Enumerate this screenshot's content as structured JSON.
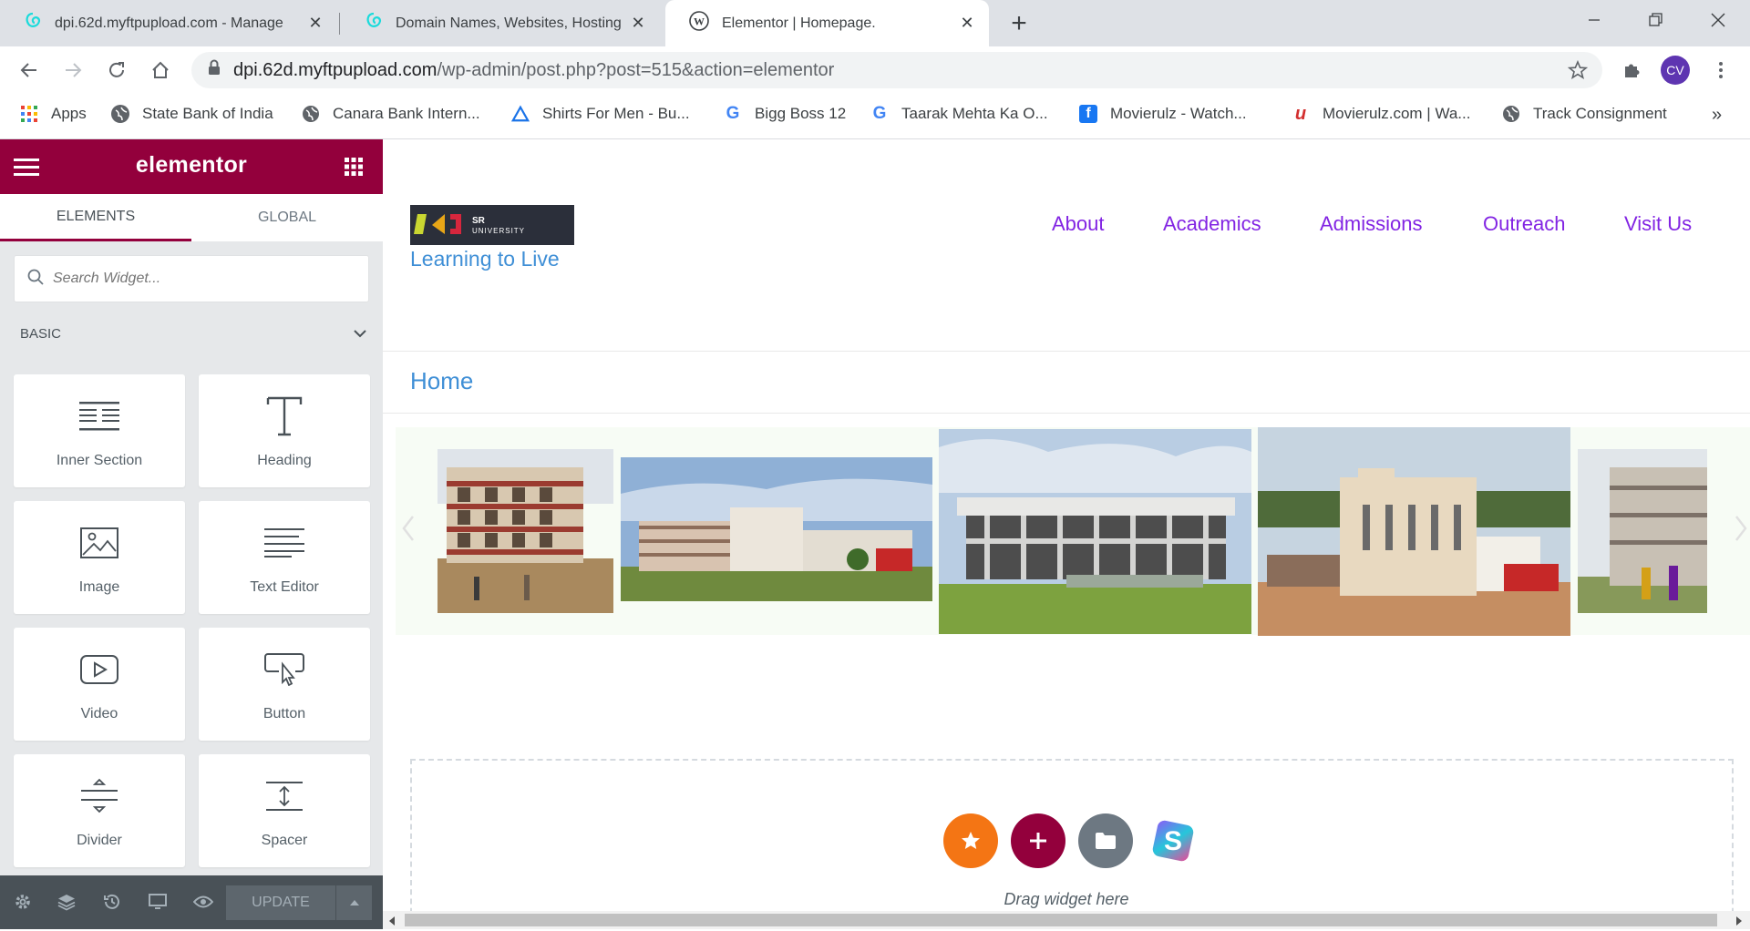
{
  "browser": {
    "tabs": [
      {
        "title": "dpi.62d.myftpupload.com - Manage",
        "icon": "godaddy-icon"
      },
      {
        "title": "Domain Names, Websites, Hosting",
        "icon": "godaddy-icon"
      },
      {
        "title": "Elementor | Homepage.",
        "icon": "wordpress-icon",
        "active": true
      }
    ],
    "new_tab": "+",
    "url_host": "dpi.62d.myftpupload.com",
    "url_path": "/wp-admin/post.php?post=515&action=elementor",
    "profile_initials": "CV",
    "bookmarks": [
      {
        "label": "Apps",
        "icon": "apps-grid-icon"
      },
      {
        "label": "State Bank of India",
        "icon": "globe-icon"
      },
      {
        "label": "Canara Bank Intern...",
        "icon": "globe-icon"
      },
      {
        "label": "Shirts For Men - Bu...",
        "icon": "triangle-logo-icon"
      },
      {
        "label": "Bigg Boss 12",
        "icon": "google-icon"
      },
      {
        "label": "Taarak Mehta Ka O...",
        "icon": "google-icon"
      },
      {
        "label": "Movierulz - Watch...",
        "icon": "facebook-icon"
      },
      {
        "label": "Movierulz.com | Wa...",
        "icon": "u-logo-icon"
      },
      {
        "label": "Track Consignment",
        "icon": "globe-icon"
      }
    ],
    "bookmarks_overflow": "»"
  },
  "panel": {
    "brand": "elementor",
    "tabs": [
      "ELEMENTS",
      "GLOBAL"
    ],
    "search_placeholder": "Search Widget...",
    "category": "BASIC",
    "widgets": [
      {
        "label": "Inner Section",
        "icon": "inner-section-icon"
      },
      {
        "label": "Heading",
        "icon": "heading-icon"
      },
      {
        "label": "Image",
        "icon": "image-icon"
      },
      {
        "label": "Text Editor",
        "icon": "text-editor-icon"
      },
      {
        "label": "Video",
        "icon": "video-icon"
      },
      {
        "label": "Button",
        "icon": "button-icon"
      },
      {
        "label": "Divider",
        "icon": "divider-icon"
      },
      {
        "label": "Spacer",
        "icon": "spacer-icon"
      }
    ],
    "update_label": "UPDATE",
    "accent_color": "#93003c"
  },
  "site": {
    "logo_text": "SR UNIVERSITY",
    "tagline": "Learning to Live",
    "nav": [
      "About",
      "Academics",
      "Admissions",
      "Outreach",
      "Visit Us"
    ],
    "page_title": "Home",
    "drop_hint": "Drag widget here",
    "link_color": "#8224e3",
    "heading_color": "#3f8fd6"
  }
}
